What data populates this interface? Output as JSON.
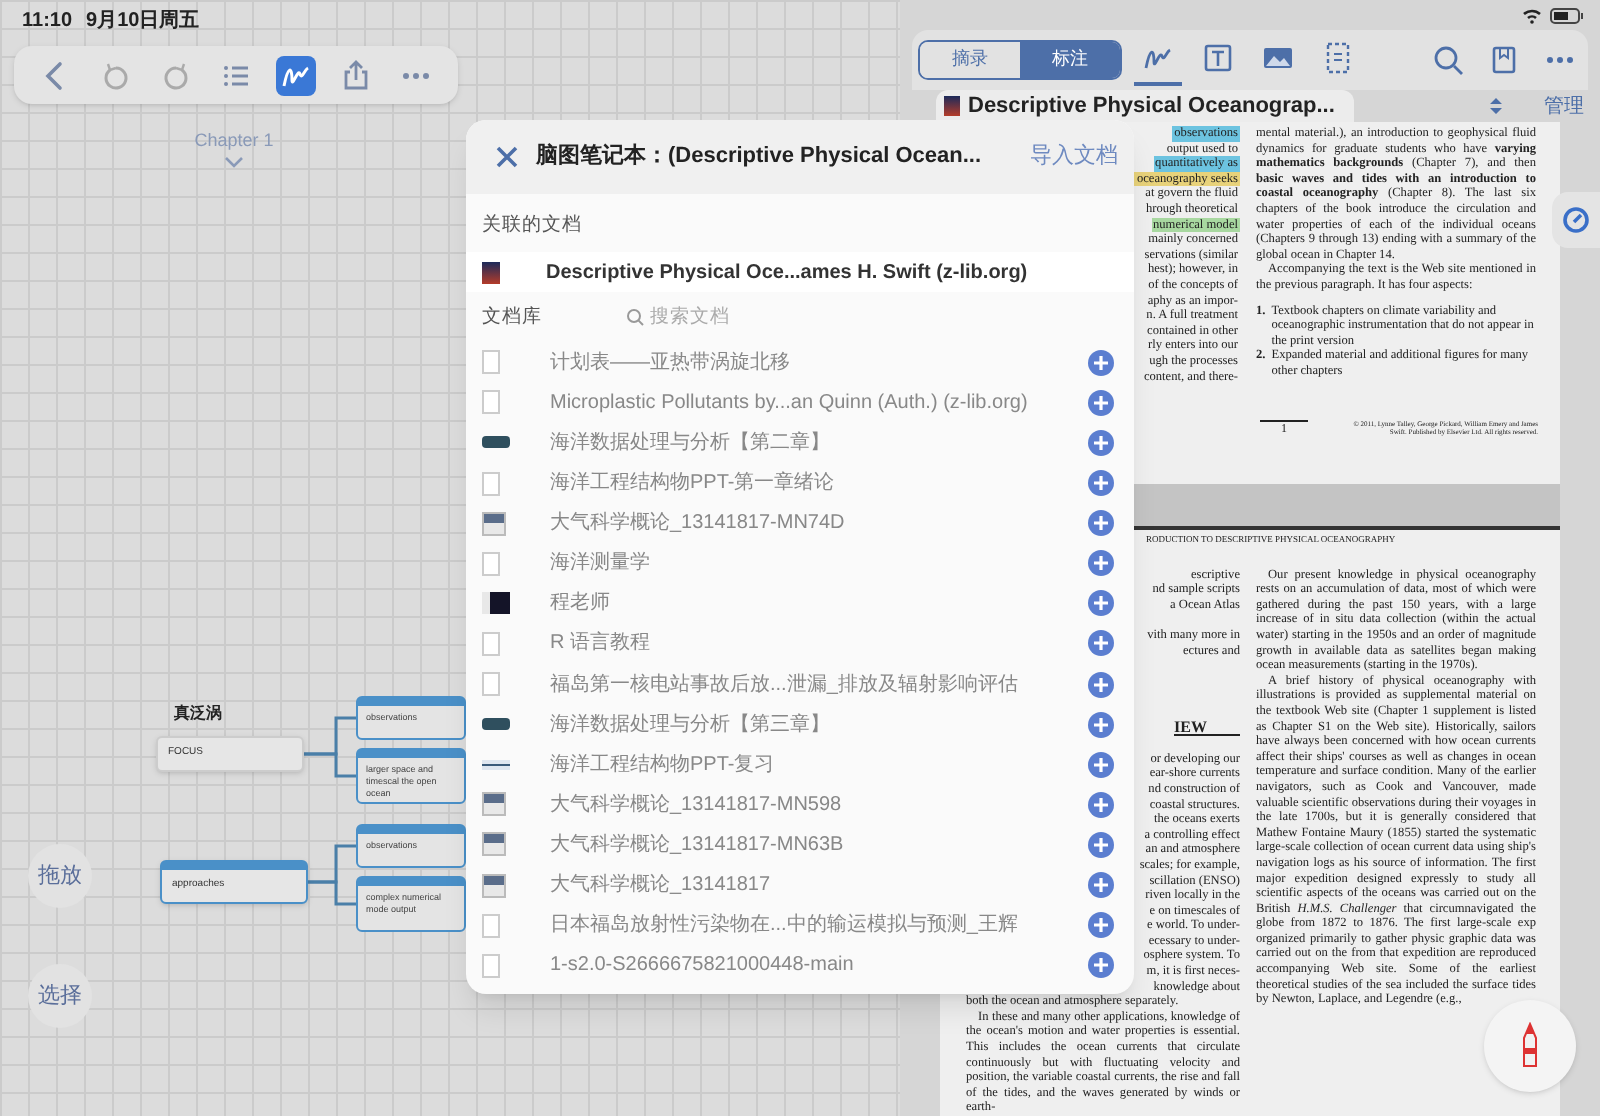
{
  "status_bar": {
    "time": "11:10",
    "date": "9月10日周五"
  },
  "left_toolbar": {
    "tools": [
      {
        "kind": "back",
        "selected": false
      },
      {
        "kind": "undo",
        "selected": false
      },
      {
        "kind": "redo",
        "selected": false
      },
      {
        "kind": "list",
        "selected": false
      },
      {
        "kind": "pen",
        "selected": true
      },
      {
        "kind": "share",
        "selected": false
      },
      {
        "kind": "more",
        "selected": false
      }
    ]
  },
  "mind_map": {
    "chapter_label": "Chapter 1",
    "title_text": "真泛涡",
    "nodes": [
      {
        "kind": "plain",
        "text": "FOCUS",
        "children": [
          {
            "kind": "header",
            "text": "observations"
          },
          {
            "kind": "header",
            "text": "larger space and timescal the open ocean"
          }
        ]
      },
      {
        "kind": "header",
        "text": "approaches",
        "children": [
          {
            "kind": "header",
            "text": "observations"
          },
          {
            "kind": "header",
            "text": "complex numerical mode output"
          }
        ]
      }
    ]
  },
  "side_buttons": [
    {
      "label": "拖放"
    },
    {
      "label": "选择"
    }
  ],
  "reader_toolbar": {
    "segments": [
      {
        "label": "摘录",
        "selected": false
      },
      {
        "label": "标注",
        "selected": true
      }
    ],
    "tools": [
      {
        "kind": "pen",
        "selected": true
      },
      {
        "kind": "text",
        "selected": false
      },
      {
        "kind": "image",
        "selected": false
      },
      {
        "kind": "frame",
        "selected": false
      }
    ],
    "actions": [
      {
        "kind": "search"
      },
      {
        "kind": "bookmark"
      },
      {
        "kind": "more"
      }
    ]
  },
  "document_tab": {
    "title": "Descriptive Physical Oceanograp...",
    "manage": "管理"
  },
  "page_1": {
    "left_fragments": [
      {
        "text": "observations",
        "color": "#6cc3e0"
      },
      {
        "text": "output used to"
      },
      {
        "text": "quantitatively as",
        "color": "#6cc3e0"
      },
      {
        "text": "oceanography seeks",
        "color": "#e8d27a"
      },
      {
        "text": "at govern the fluid"
      },
      {
        "text": "hrough theoretical"
      },
      {
        "text": "numerical model",
        "color": "#a8d8a0"
      },
      {
        "text": "mainly concerned"
      },
      {
        "text": "servations (similar"
      },
      {
        "text": "hest); however, in"
      },
      {
        "text": "of the concepts of"
      },
      {
        "text": "aphy as an impor-"
      },
      {
        "text": "n. A full treatment"
      },
      {
        "text": "contained in other"
      },
      {
        "text": "rly enters into our"
      },
      {
        "text": "ugh the processes"
      },
      {
        "text": "content, and there-"
      }
    ],
    "right_paragraphs": [
      {
        "kind": "text",
        "text": "mental material.), an introduction to geophysical fluid dynamics for graduate students who have **varying mathematics backgrounds** (Chapter 7), and then **basic waves and tides with an introduction to coastal oceanography** (Chapter 8). The last six chapters of the book introduce the circulation and water properties of each of the individual oceans (Chapters 9 through 13) ending with a summary of the global ocean in Chapter 14."
      },
      {
        "kind": "text",
        "text": "Accompanying the text is the Web site mentioned in the previous paragraph. It has four aspects:"
      },
      {
        "kind": "item",
        "marker": "1.",
        "text": "Textbook chapters on climate variability and oceanographic instrumentation that do not appear in the print version"
      },
      {
        "kind": "item",
        "marker": "2.",
        "text": "Expanded material and additional figures for many other chapters"
      }
    ],
    "page_number": "1",
    "copyright": "© 2011, Lynne Talley, George Pickard, William Emery and James Swift. Published by Elsevier Ltd. All rights reserved."
  },
  "page_2": {
    "running_head": "RODUCTION TO DESCRIPTIVE PHYSICAL OCEANOGRAPHY",
    "left_fragments": [
      {
        "kind": "line",
        "text": "escriptive"
      },
      {
        "kind": "line",
        "text": "nd sample scripts"
      },
      {
        "kind": "line",
        "text": "a Ocean Atlas"
      },
      {
        "kind": "blank"
      },
      {
        "kind": "line",
        "text": "vith many more in"
      },
      {
        "kind": "line",
        "text": "ectures and"
      },
      {
        "kind": "blank"
      },
      {
        "kind": "blank"
      },
      {
        "kind": "blank"
      },
      {
        "kind": "blank"
      },
      {
        "kind": "heading",
        "text": "IEW"
      },
      {
        "kind": "blank"
      },
      {
        "kind": "line",
        "text": "or developing our"
      },
      {
        "kind": "line",
        "text": "ear-shore currents"
      },
      {
        "kind": "line",
        "text": "nd construction of"
      },
      {
        "kind": "line",
        "text": "coastal structures."
      },
      {
        "kind": "line",
        "text": "the oceans exerts"
      },
      {
        "kind": "line",
        "text": "a controlling effect"
      },
      {
        "kind": "line",
        "text": "an and atmosphere"
      },
      {
        "kind": "line",
        "text": "scales; for example,"
      },
      {
        "kind": "line",
        "text": "scillation (ENSO)"
      },
      {
        "kind": "line",
        "text": "riven locally in the"
      },
      {
        "kind": "line",
        "text": "e on timescales of"
      },
      {
        "kind": "line",
        "text": "e world. To under-"
      },
      {
        "kind": "line",
        "text": "ecessary to under-"
      },
      {
        "kind": "line",
        "text": "osphere system. To"
      },
      {
        "kind": "line",
        "text": "m, it is first neces-"
      },
      {
        "kind": "line",
        "text": "knowledge about"
      }
    ],
    "left_paragraphs": [
      "both the ocean and atmosphere separately.",
      "In these and many other applications, knowledge of the ocean's motion and water properties is essential. This includes the ocean currents that circulate continuously but with fluctuating velocity and position, the variable coastal currents, the rise and fall of the tides, and the waves generated by winds or earth-"
    ],
    "right_paragraphs": [
      "Our present knowledge in physical oceanography rests on an accumulation of data, most of which were gathered during the past 150 years, with a large increase of in situ data collection (within the actual water) starting in the 1950s and an order of magnitude growth in available data as satellites began making ocean measurements (starting in the 1970s).",
      "A brief history of physical oceanography with illustrations is provided as supplemental material on the textbook Web site (Chapter 1 supplement is listed as Chapter S1 on the Web site). Historically, sailors have always been concerned with how ocean currents affect their ships' courses as well as changes in ocean temperature and surface condition. Many of the earlier navigators, such as Cook and Vancouver, made valuable scientific observations during their voyages in the late 1700s, but it is generally considered that Mathew Fontaine Maury (1855) started the systematic large-scale collection of ocean current data using ship's navigation logs as his source of information. The first major expedition designed expressly to study all scientific aspects of the oceans was carried out on the British *H.M.S. Challenger* that circumnavigated the globe from 1872 to 1876. The first large-scale exp organized primarily to gather physic graphic data was carried out on the from that expedition are reproduced accompanying Web site. Some of the earliest theoretical studies of the sea included the surface tides by Newton, Laplace, and Legendre (e.g.,"
    ]
  },
  "modal": {
    "title": "脑图笔记本：(Descriptive Physical Ocean...",
    "import": "导入文档",
    "linked_label": "关联的文档",
    "linked_doc": "Descriptive Physical Oce...ames H. Swift (z-lib.org)",
    "library_label": "文档库",
    "search_placeholder": "搜索文档",
    "documents": [
      {
        "title": "计划表——亚热带涡旋北移",
        "kind": "page"
      },
      {
        "title": "Microplastic Pollutants by...an Quinn (Auth.) (z-lib.org)",
        "kind": "page"
      },
      {
        "title": "海洋数据处理与分析【第二章】",
        "kind": "banner"
      },
      {
        "title": "海洋工程结构物PPT-第一章绪论",
        "kind": "page"
      },
      {
        "title": "大气科学概论_13141817-MN74D",
        "kind": "slide"
      },
      {
        "title": "海洋测量学",
        "kind": "page"
      },
      {
        "title": "程老师",
        "kind": "dark"
      },
      {
        "title": "R 语言教程",
        "kind": "page"
      },
      {
        "title": "福岛第一核电站事故后放...泄漏_排放及辐射影响评估",
        "kind": "page"
      },
      {
        "title": "海洋数据处理与分析【第三章】",
        "kind": "banner"
      },
      {
        "title": "海洋工程结构物PPT-复习",
        "kind": "strip"
      },
      {
        "title": "大气科学概论_13141817-MN598",
        "kind": "slide"
      },
      {
        "title": "大气科学概论_13141817-MN63B",
        "kind": "slide"
      },
      {
        "title": "大气科学概论_13141817",
        "kind": "slide"
      },
      {
        "title": "日本福岛放射性污染物在...中的输运模拟与预测_王辉",
        "kind": "page"
      },
      {
        "title": "1-s2.0-S2666675821000448-main",
        "kind": "page"
      }
    ]
  }
}
